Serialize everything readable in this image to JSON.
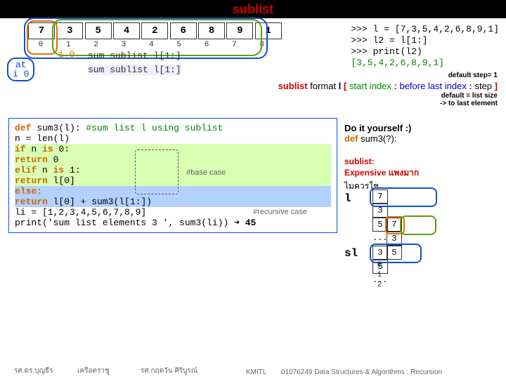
{
  "title_white": "",
  "title_red": "sublist",
  "array_values": [
    "7",
    "3",
    "5",
    "4",
    "2",
    "6",
    "8",
    "9",
    "1"
  ],
  "index_values": [
    "0",
    "1",
    "2",
    "3",
    "4",
    "5",
    "6",
    "7",
    "8"
  ],
  "i0_label": "i 0",
  "at_label": "at",
  "at_i0": "i 0",
  "sum_label_1": "sum sublist l[1:]",
  "sum_label_2": "sum sublist l[1:]",
  "repl": {
    "l1": ">>> l = [7,3,5,4,2,6,8,9,1]",
    "l2": ">>> l2 = l[1:]",
    "l3": ">>> print(l2)",
    "l4": "[3,5,4,2,6,8,9,1]"
  },
  "note_defstep": "default step= 1",
  "format_prefix": "sublist",
  "format_word": " format  ",
  "format_l": "l",
  "format_open": "[ ",
  "format_start": "start index",
  "format_sep": " : ",
  "format_before": "before last index",
  "format_step": "step",
  "format_close": "]",
  "note_defsize1": "default = list size",
  "note_defsize2": "-> to last element",
  "code": {
    "l1a": "def",
    "l1b": " sum3(l):",
    "l1c": " #sum list l using sublist",
    "l2": "    n = len(l)",
    "l3": "",
    "l4a": "    if",
    "l4b": " n ",
    "l4c": "is",
    "l4d": " 0:",
    "l5a": "        return",
    "l5b": " 0",
    "l6a": "    elif",
    "l6b": " n ",
    "l6c": "is",
    "l6d": " 1:",
    "l7a": "        return",
    "l7b": " l[0]",
    "l8a": "    else:",
    "l9a": "        return",
    "l9b": " l[0] + ",
    "l9c": "sum3(l[1:])",
    "l10": "",
    "l11": "li = [1,2,3,4,5,6,7,8,9]",
    "l12a": "print('sum list elements 3 ', sum3(li))",
    "l12b": " ➜ ",
    "l12c": "45"
  },
  "case_base": "#base case",
  "case_rec": "#recursive case",
  "doit": {
    "l1": "Do it yourself :)",
    "l2a": "def",
    "l2b": " sum3(?):"
  },
  "sublist_note": {
    "l1": "sublist:",
    "l2": "Expensive แพงมาก",
    "l3": "ไมควรใช"
  },
  "diag": {
    "l_label": "l",
    "sl_label": "sl",
    "top_vals": [
      "7",
      "3",
      "5",
      "..."
    ],
    "mid_vals": [
      "7",
      "3",
      "5"
    ],
    "bot_vals": [
      "3",
      "5",
      "..."
    ],
    "bot_idx": [
      "0",
      "1",
      "2"
    ]
  },
  "footer": {
    "a": "รศ.ดร.บุญธีร",
    "b": "เครือตราชู",
    "c": "รศ.กฤตวัน  ศิริบูรณ์",
    "d": "KMITL",
    "e": "01076249 Data Structures & Algorithms : Recursion"
  }
}
